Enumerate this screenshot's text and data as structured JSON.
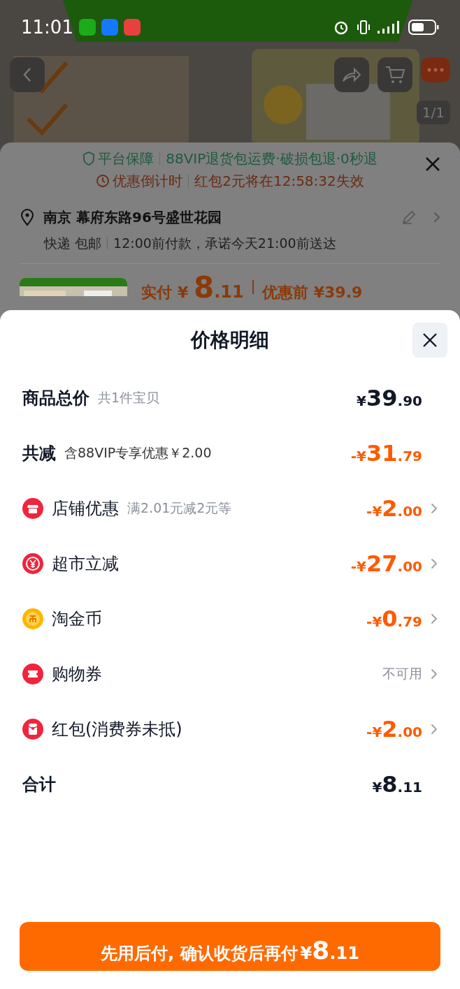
{
  "status_bar": {
    "time": "11:01"
  },
  "top_bar": {
    "page_indicator": "1/1"
  },
  "order_sheet": {
    "guarantee": {
      "label": "平台保障",
      "text": "88VIP退货包运费·破损包退·0秒退"
    },
    "countdown": {
      "label": "优惠倒计时",
      "text": "红包2元将在12:58:32失效"
    },
    "address": "南京 幕府东路96号盛世花园",
    "delivery": {
      "method": "快递 包邮",
      "promise": "12:00前付款，承诺今天21:00前送达"
    },
    "paid": {
      "label": "实付",
      "currency": "¥",
      "main": "8",
      "cents": ".11"
    },
    "original": {
      "label": "优惠前",
      "value": "¥39.9"
    }
  },
  "price_detail": {
    "title": "价格明细",
    "rows": [
      {
        "kind": "summary",
        "label": "商品总价",
        "note": "共1件宝贝",
        "amount": {
          "sign": "¥",
          "main": "39",
          "cents": ".90"
        },
        "color": "#111827",
        "chevron": false
      },
      {
        "kind": "summary",
        "label": "共减",
        "note": "含88VIP专享优惠￥2.00",
        "amount": {
          "sign": "-¥",
          "main": "31",
          "cents": ".79"
        },
        "color": "#ff5a00",
        "chevron": false
      },
      {
        "kind": "shop",
        "label": "店铺优惠",
        "note": "满2.01元减2元等",
        "amount": {
          "sign": "-¥",
          "main": "2",
          "cents": ".00"
        },
        "color": "#ff5a00",
        "chevron": true
      },
      {
        "kind": "yuan",
        "label": "超市立减",
        "amount": {
          "sign": "-¥",
          "main": "27",
          "cents": ".00"
        },
        "color": "#ff5a00",
        "chevron": true
      },
      {
        "kind": "coin",
        "label": "淘金币",
        "amount": {
          "sign": "-¥",
          "main": "0",
          "cents": ".79"
        },
        "color": "#ff5a00",
        "chevron": true
      },
      {
        "kind": "ticket",
        "label": "购物券",
        "status": "不可用",
        "color": "#8a8f99",
        "chevron": true
      },
      {
        "kind": "envelope",
        "label": "红包(消费券未抵)",
        "amount": {
          "sign": "-¥",
          "main": "2",
          "cents": ".00"
        },
        "color": "#ff5a00",
        "chevron": true
      },
      {
        "kind": "summary",
        "label": "合计",
        "amount": {
          "sign": "¥",
          "main": "8",
          "cents": ".11"
        },
        "color": "#111827",
        "chevron": false
      }
    ],
    "pay_button": {
      "text": "先用后付, 确认收货后再付",
      "currency": "¥",
      "main": "8",
      "cents": ".11"
    }
  }
}
